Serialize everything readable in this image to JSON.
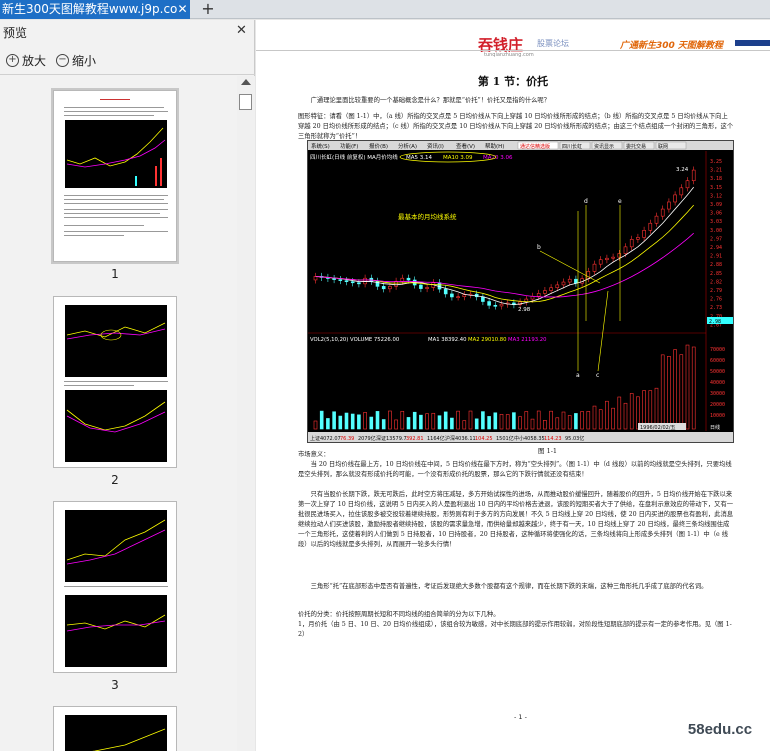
{
  "tab": {
    "title": "新生300天图解教程www.j9p.co"
  },
  "sidebar": {
    "title": "预览",
    "zoom_in_label": "放大",
    "zoom_out_label": "缩小",
    "pages": [
      "1",
      "2",
      "3"
    ]
  },
  "document": {
    "logo": "吞钱庄",
    "logo_sub": "股票论坛",
    "logo_url": "tunqianzhuang.com",
    "header_right": "广通新生300 天图解教程",
    "section_title": "第 1 节：价托",
    "intro": "广通理论里面比较重要的一个基础概念是什么？那就是“价托”！价托又是指的什么呢？",
    "def_paragraph": "图形特征：请看（图 1-1）中，（a 线）所指的交叉点是 5 日均价线从下向上穿越 10 日均价线所形成的结点；（b 线）所指的交叉点是 5 日均价线从下向上穿越 20 日均价线所形成的结点；（c 线）所指的交叉点是 10 日均价线从下向上穿越 20 日均价线所形成的结点；由这三个结点组成一个封闭的三角形，这个三角形就称为“价托”！",
    "figure_caption": "图 1-1",
    "market_heading": "市场意义：",
    "market_p1": "当 20 日均价线在最上方，10 日均价线在中间，5 日均价线在最下方时，称为“空头排列”。（图 1-1）中（d 线段）以前的均线就是空头排列，只要均线是空头排列，那么就没有形成价托的可能，一个没有形成价托的股票，那么它的下跌行情就还没有结束！",
    "market_p2": "只有当股价长期下跌，跌无可跌后，此时空方将压减轻，多方开始试探性的进场，从而推动股价缓慢回升，随着股价的回升，5 日均价线开始在下跌以来第一次上穿了 10 日均价线，这说明 5 日内买入的人是盈利退出 10 日内的平均价格去进退，该股的短期买者大于了供给，在盘利示意效应的带动下，又有一批很民进场买入，拉住该股多被交投较着继续持股，形势则有利于多方的方向发展！不久 5 日均线上穿 20 日均线，使 20 日内买进的股票也有盈利，此消息继续拉动人们买进该股，激励持股者继续持股，该股的需求量急增，而供给量却越来越少，终于有一天，10 日均线上穿了 20 日均线，最终三条均线围住成一个三角形托，这使着利的人们做到 5 日持股者，10 日持股者，20 日持股者，这种循环将使强化的话，三条均线将向上形成多头排列（图 1-1）中（e 线段）以后的均线就是多头排列，从而展开一轮多头行情！",
    "market_p3": "三角形“托”在底部形态中是否有普遍性，考证后发现绝大多数个股都有这个规律，而在长期下跌的末端，这种三角形托几乎成了底部的代名词。",
    "classify_p": "价托的分类：价托按照周期长短和不同均线的组合简单的分为以下几种。",
    "classify_1": "1，月价托（由 5 日、10 日、20 日均价线组成），该组合较为敏感，对中长期底部的提示作用较弱，对阶段性短期底部的提示有一定的参考作用。见（图 1-2）",
    "page_number": "- 1 -"
  },
  "chart": {
    "menu": [
      "系统(S)",
      "功能(F)",
      "报价(B)",
      "分析(A)",
      "资讯(I)",
      "查看(V)",
      "帮助(H)"
    ],
    "menu_right": [
      "通达信精选版",
      "四川长虹",
      "资讯显示",
      "委托交易",
      "联网"
    ],
    "stock_label": "四川长虹(日线 前复权)",
    "ma_label": "MA月价均线",
    "ma5": "MA5 3.14",
    "ma10": "MA10 3.09",
    "ma20": "MA20 3.06",
    "annot_text": "最基本的月均线系统",
    "high_price": "3.24",
    "low_price": "2.98",
    "last_price": "2.98",
    "price_axis": [
      "3.25",
      "3.21",
      "3.18",
      "3.15",
      "3.12",
      "3.09",
      "3.06",
      "3.03",
      "3.00",
      "2.97",
      "2.94",
      "2.91",
      "2.88",
      "2.85",
      "2.82",
      "2.79",
      "2.76",
      "2.73",
      "2.70",
      "2.67"
    ],
    "vol_label": "VOL2(5,10,20) VOLUME 75226.00",
    "vol_ma1": "MA1 38392.40",
    "vol_ma2": "MA2 29010.80",
    "vol_ma3": "MA3 21193.20",
    "vol_axis": [
      "70000",
      "60000",
      "50000",
      "40000",
      "30000",
      "20000",
      "10000"
    ],
    "line_labels": [
      "a",
      "b",
      "c",
      "d",
      "e"
    ],
    "date_label": "1996/02/02/五",
    "day_label": "日线",
    "status": [
      "上证4072.07",
      "76.39",
      "2079亿",
      "深证13579.7",
      "392.81",
      "1164亿",
      "沪深4036.11",
      "104.25",
      "1501亿",
      "中小4058.35",
      "114.23",
      "95.03亿"
    ],
    "colors": {
      "bg": "#000000",
      "up": "#ff3232",
      "down": "#54ffff",
      "ma5": "#ffffff",
      "ma10": "#ffff00",
      "ma20": "#ff00ff",
      "annot": "#ffff00"
    }
  },
  "watermark": "58edu.cc"
}
